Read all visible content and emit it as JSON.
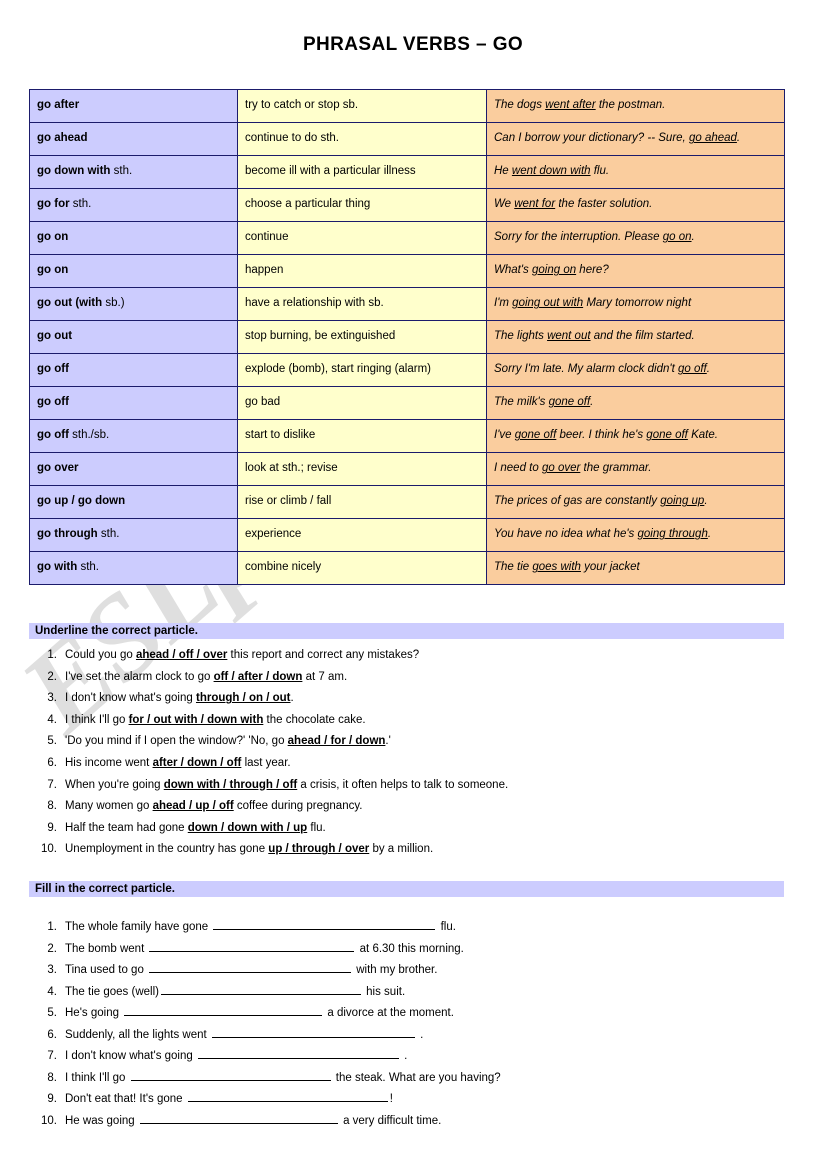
{
  "title": "PHRASAL VERBS – GO",
  "watermark": "ESLprintables.com",
  "colors": {
    "verb_column": "#CCCCFE",
    "definition_column": "#FFFFCC",
    "example_column": "#FACD9E",
    "border": "#1B1B6B",
    "section_bar": "#CCCCFE"
  },
  "table": {
    "rows": [
      {
        "verb_bold": "go after",
        "verb_suffix": "",
        "definition": "try to catch or stop sb.",
        "example_parts": [
          {
            "text": "The dogs ",
            "underline": false
          },
          {
            "text": "went after",
            "underline": true
          },
          {
            "text": " the postman.",
            "underline": false
          }
        ],
        "example_plain": "The dogs went after the postman."
      },
      {
        "verb_bold": "go ahead",
        "verb_suffix": "",
        "definition": "continue to do sth.",
        "example_parts": [
          {
            "text": "Can I borrow your dictionary? -- Sure, ",
            "underline": false
          },
          {
            "text": "go ahead",
            "underline": true
          },
          {
            "text": ".",
            "underline": false
          }
        ],
        "example_plain": "Can I borrow your dictionary? -- Sure, go ahead."
      },
      {
        "verb_bold": "go down with",
        "verb_suffix": " sth.",
        "definition": "become ill with a particular illness",
        "example_parts": [
          {
            "text": "He ",
            "underline": false
          },
          {
            "text": "went down with",
            "underline": true
          },
          {
            "text": " flu.",
            "underline": false
          }
        ],
        "example_plain": "He went down with flu."
      },
      {
        "verb_bold": "go for",
        "verb_suffix": " sth.",
        "definition": "choose a particular thing",
        "example_parts": [
          {
            "text": "We ",
            "underline": false
          },
          {
            "text": "went for",
            "underline": true
          },
          {
            "text": " the faster solution.",
            "underline": false
          }
        ],
        "example_plain": "We went for the faster solution."
      },
      {
        "verb_bold": "go on",
        "verb_suffix": "",
        "definition": "continue",
        "example_parts": [
          {
            "text": "Sorry for the interruption. Please ",
            "underline": false
          },
          {
            "text": "go on",
            "underline": true
          },
          {
            "text": ".",
            "underline": false
          }
        ],
        "example_plain": "Sorry for the interruption. Please go on."
      },
      {
        "verb_bold": "go on",
        "verb_suffix": "",
        "definition": "happen",
        "example_parts": [
          {
            "text": "What's ",
            "underline": false
          },
          {
            "text": "going on",
            "underline": true
          },
          {
            "text": " here?",
            "underline": false
          }
        ],
        "example_plain": "What's going on here?"
      },
      {
        "verb_bold": "go out (with",
        "verb_suffix": " sb.)",
        "definition": "have a relationship with sb.",
        "example_parts": [
          {
            "text": "I'm ",
            "underline": false
          },
          {
            "text": "going out with",
            "underline": true
          },
          {
            "text": " Mary tomorrow night",
            "underline": false
          }
        ],
        "example_plain": "I'm going out with Mary tomorrow night"
      },
      {
        "verb_bold": "go out",
        "verb_suffix": "",
        "definition": "stop burning, be extinguished",
        "example_parts": [
          {
            "text": "The lights ",
            "underline": false
          },
          {
            "text": "went out",
            "underline": true
          },
          {
            "text": " and the film started.",
            "underline": false
          }
        ],
        "example_plain": "The lights went out and the film started."
      },
      {
        "verb_bold": "go off",
        "verb_suffix": "",
        "definition": "explode (bomb), start ringing (alarm)",
        "example_parts": [
          {
            "text": "Sorry I'm late. My alarm clock didn't ",
            "underline": false
          },
          {
            "text": "go off",
            "underline": true
          },
          {
            "text": ".",
            "underline": false
          }
        ],
        "example_plain": "Sorry I'm late. My alarm clock didn't go off."
      },
      {
        "verb_bold": "go off",
        "verb_suffix": "",
        "definition": "go bad",
        "example_parts": [
          {
            "text": "The milk's ",
            "underline": false
          },
          {
            "text": "gone off",
            "underline": true
          },
          {
            "text": ".",
            "underline": false
          }
        ],
        "example_plain": "The milk's gone off."
      },
      {
        "verb_bold": "go off",
        "verb_suffix": " sth./sb.",
        "definition": "start to dislike",
        "example_parts": [
          {
            "text": "I've ",
            "underline": false
          },
          {
            "text": "gone off",
            "underline": true
          },
          {
            "text": " beer. I think he's ",
            "underline": false
          },
          {
            "text": "gone off",
            "underline": true
          },
          {
            "text": " Kate.",
            "underline": false
          }
        ],
        "example_plain": "I've gone off beer. I think he's gone off Kate."
      },
      {
        "verb_bold": "go over",
        "verb_suffix": "",
        "definition": "look at sth.; revise",
        "example_parts": [
          {
            "text": "I need to ",
            "underline": false
          },
          {
            "text": "go over",
            "underline": true
          },
          {
            "text": " the grammar.",
            "underline": false
          }
        ],
        "example_plain": "I need to go over the grammar."
      },
      {
        "verb_bold": "go up / go down",
        "verb_suffix": "",
        "definition": "rise or climb / fall",
        "example_parts": [
          {
            "text": "The prices of gas are constantly ",
            "underline": false
          },
          {
            "text": "going up",
            "underline": true
          },
          {
            "text": ".",
            "underline": false
          }
        ],
        "example_plain": "The prices of gas are constantly going up."
      },
      {
        "verb_bold": "go through",
        "verb_suffix": " sth.",
        "definition": "experience",
        "example_parts": [
          {
            "text": "You have no idea what he's ",
            "underline": false
          },
          {
            "text": "going through",
            "underline": true
          },
          {
            "text": ".",
            "underline": false
          }
        ],
        "example_plain": "You have no idea what he's going through."
      },
      {
        "verb_bold": "go with",
        "verb_suffix": " sth.",
        "definition": "combine nicely",
        "example_parts": [
          {
            "text": "The tie ",
            "underline": false
          },
          {
            "text": "goes with",
            "underline": true
          },
          {
            "text": " your jacket",
            "underline": false
          }
        ],
        "example_plain": "The tie goes with your jacket"
      }
    ]
  },
  "exercise_underline": {
    "heading": "Underline the correct particle.",
    "items": [
      {
        "number": "1.",
        "parts": [
          {
            "text": "Could you go ",
            "bold": false
          },
          {
            "text": "ahead / off / over",
            "bold": true
          },
          {
            "text": " this report and correct any mistakes?",
            "bold": false
          }
        ],
        "plain": "Could you go ahead / off / over this report and correct any mistakes?"
      },
      {
        "number": "2.",
        "parts": [
          {
            "text": "I've set the alarm clock to go ",
            "bold": false
          },
          {
            "text": "off / after / down",
            "bold": true
          },
          {
            "text": " at 7 am.",
            "bold": false
          }
        ],
        "plain": "I've set the alarm clock to go off / after / down at 7 am."
      },
      {
        "number": "3.",
        "parts": [
          {
            "text": "I don't know what's going ",
            "bold": false
          },
          {
            "text": "through / on / out",
            "bold": true
          },
          {
            "text": ".",
            "bold": false
          }
        ],
        "plain": "I don't know what's going through / on / out."
      },
      {
        "number": "4.",
        "parts": [
          {
            "text": "I think I'll go  ",
            "bold": false
          },
          {
            "text": "for / out with / down with",
            "bold": true
          },
          {
            "text": " the chocolate cake.",
            "bold": false
          }
        ],
        "plain": "I think I'll go for / out with / down with the chocolate cake."
      },
      {
        "number": "5.",
        "parts": [
          {
            "text": "'Do you mind if I open the window?' 'No, go ",
            "bold": false
          },
          {
            "text": "ahead / for / down",
            "bold": true
          },
          {
            "text": ".'",
            "bold": false
          }
        ],
        "plain": "'Do you mind if I open the window?' 'No, go ahead / for / down.'"
      },
      {
        "number": "6.",
        "parts": [
          {
            "text": "His income went ",
            "bold": false
          },
          {
            "text": "after / down / off",
            "bold": true
          },
          {
            "text": " last year.",
            "bold": false
          }
        ],
        "plain": "His income went after / down / off last year."
      },
      {
        "number": "7.",
        "parts": [
          {
            "text": "When you're going ",
            "bold": false
          },
          {
            "text": "down with / through / off",
            "bold": true
          },
          {
            "text": " a crisis, it often helps to talk to someone.",
            "bold": false
          }
        ],
        "plain": "When you're going down with / through / off a crisis, it often helps to talk to someone."
      },
      {
        "number": "8.",
        "parts": [
          {
            "text": "Many women go ",
            "bold": false
          },
          {
            "text": "ahead / up / off",
            "bold": true
          },
          {
            "text": " coffee during pregnancy.",
            "bold": false
          }
        ],
        "plain": "Many women go ahead / up / off coffee during pregnancy."
      },
      {
        "number": "9.",
        "parts": [
          {
            "text": "Half the team had gone  ",
            "bold": false
          },
          {
            "text": "down / down with / up",
            "bold": true
          },
          {
            "text": " flu.",
            "bold": false
          }
        ],
        "plain": "Half the team had gone down / down with / up flu."
      },
      {
        "number": "10.",
        "parts": [
          {
            "text": "Unemployment in the country has gone ",
            "bold": false
          },
          {
            "text": "up / through / over",
            "bold": true
          },
          {
            "text": " by a million.",
            "bold": false
          }
        ],
        "plain": "Unemployment in the country has gone up / through / over by a million."
      }
    ]
  },
  "exercise_fillin": {
    "heading": "Fill in the correct particle.",
    "items": [
      {
        "number": "1.",
        "before": "The whole family have gone ",
        "blank_width": 222,
        "after": " flu.",
        "plain": "The whole family have gone ____________ flu."
      },
      {
        "number": "2.",
        "before": "The bomb went ",
        "blank_width": 205,
        "after": " at 6.30 this morning.",
        "plain": "The bomb went ____________ at 6.30 this morning."
      },
      {
        "number": "3.",
        "before": "Tina used to go ",
        "blank_width": 202,
        "after": " with my brother.",
        "plain": "Tina used to go ____________ with my brother."
      },
      {
        "number": "4.",
        "before": "The tie goes (well)",
        "blank_width": 200,
        "after": " his suit.",
        "plain": "The tie goes (well) ____________ his suit."
      },
      {
        "number": "5.",
        "before": "He's going ",
        "blank_width": 198,
        "after": " a divorce at the moment.",
        "plain": "He's going ____________ a divorce at the moment."
      },
      {
        "number": "6.",
        "before": "Suddenly, all the lights went ",
        "blank_width": 203,
        "after": " .",
        "plain": "Suddenly, all the lights went ____________ ."
      },
      {
        "number": "7.",
        "before": "I don't know what's going ",
        "blank_width": 201,
        "after": " .",
        "plain": "I don't know what's going ____________ ."
      },
      {
        "number": "8.",
        "before": "I think I'll go ",
        "blank_width": 200,
        "after": " the steak. What are you having?",
        "plain": "I think I'll go ____________ the steak. What are you having?"
      },
      {
        "number": "9.",
        "before": "Don't eat that! It's gone ",
        "blank_width": 200,
        "after": "!",
        "plain": "Don't eat that! It's gone ____________!"
      },
      {
        "number": "10.",
        "before": "He was going ",
        "blank_width": 198,
        "after": " a very difficult time.",
        "plain": "He was going ____________ a very difficult time."
      }
    ]
  }
}
